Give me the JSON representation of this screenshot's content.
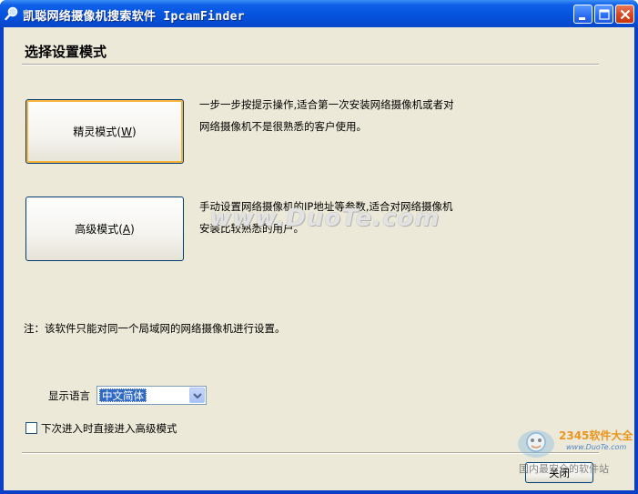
{
  "window": {
    "title": "凯聪网络摄像机搜索软件 IpcamFinder"
  },
  "titlebar_buttons": {
    "minimize_icon": "minimize-icon",
    "maximize_icon": "maximize-icon",
    "close_icon": "close-icon"
  },
  "main": {
    "heading": "选择设置模式",
    "wizard": {
      "label": "精灵模式(",
      "hotkey": "W",
      "label_end": ")",
      "desc_line1": "一步一步按提示操作,适合第一次安装网络摄像机或者对",
      "desc_line2": "网络摄像机不是很熟悉的客户使用。"
    },
    "advanced": {
      "label": "高级模式(",
      "hotkey": "A",
      "label_end": ")",
      "desc_line1": "手动设置网络摄像机的IP地址等参数,适合对网络摄像机",
      "desc_line2": "安装比较熟悉的用户。"
    },
    "note": "注：该软件只能对同一个局域网的网络摄像机进行设置。",
    "language": {
      "label": "显示语言",
      "selected": "中文简体"
    },
    "checkbox_label": "下次进入时直接进入高级模式",
    "close_button": "关闭"
  },
  "watermark": "www.DuoTe.com",
  "corner_watermark": {
    "brand": "2345软件大全",
    "url": "www.DuoTe.com",
    "text": "国内最安全的软件站"
  },
  "colors": {
    "titlebar": "#0552dc",
    "client_bg": "#ece9d8",
    "selection": "#316ac5",
    "focus_ring": "#f8b33a"
  }
}
